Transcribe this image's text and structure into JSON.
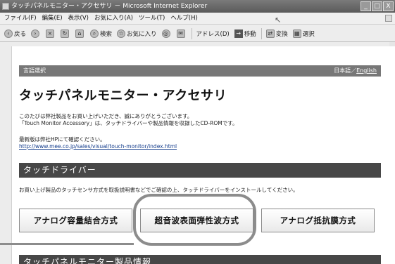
{
  "window": {
    "title": "タッチパネルモニター・アクセサリ － Microsoft Internet Explorer",
    "controls": [
      "_",
      "□",
      "X"
    ]
  },
  "menubar": {
    "items": [
      "ファイル(F)",
      "編集(E)",
      "表示(V)",
      "お気に入り(A)",
      "ツール(T)",
      "ヘルプ(H)"
    ]
  },
  "toolbar": {
    "back": "戻る",
    "search": "検索",
    "favorites": "お気に入り",
    "address": "アドレス(D)",
    "go": "移動",
    "convert": "変換",
    "select": "選択"
  },
  "page": {
    "lang_bar": {
      "left": "言語選択",
      "right_prefix": "日本語／",
      "english": "English"
    },
    "title": "タッチパネルモニター・アクセサリ",
    "desc_line1": "このたびは弊社製品をお買い上げいただき、誠にありがとうございます。",
    "desc_line2": "「Touch Monitor Accessory」は、タッチドライバーや製品情報を収録したCD-ROMです。",
    "latest_info": "最新版は弊社HPにて確認ください。",
    "url": "http://www.mee.co.jp/sales/visual/touch-monitor/index.html",
    "section1": "タッチドライバー",
    "install_text": "お買い上げ製品のタッチセンサ方式を取扱説明書などでご確認の上、タッチドライバーをインストールしてください。",
    "buttons": [
      "アナログ容量結合方式",
      "超音波表面弾性波方式",
      "アナログ抵抗膜方式"
    ],
    "section2": "タッチパネルモニター製品情報"
  }
}
